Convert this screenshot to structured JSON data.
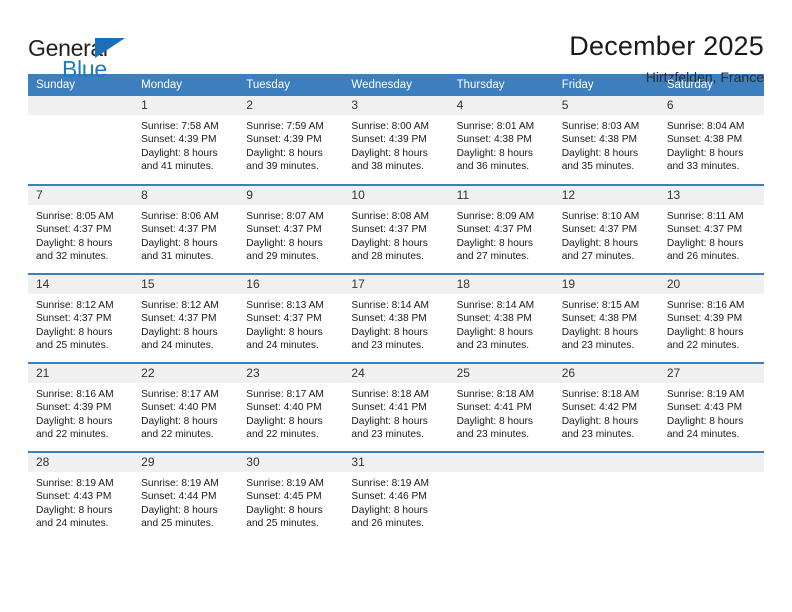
{
  "brand": {
    "name_top": "General",
    "name_bottom": "Blue",
    "triangle_icon": "triangle-icon",
    "color_blue": "#1f7ac4",
    "color_dark": "#231f20"
  },
  "header": {
    "title": "December 2025",
    "subtitle": "Hirtzfelden, France"
  },
  "theme": {
    "header_row_bg": "#3c7ebe",
    "daynum_bg": "#f0f0f0",
    "grid_line": "#3c7ebe"
  },
  "weekdays": [
    "Sunday",
    "Monday",
    "Tuesday",
    "Wednesday",
    "Thursday",
    "Friday",
    "Saturday"
  ],
  "weeks": [
    [
      {
        "day": "",
        "sunrise": "",
        "sunset": "",
        "daylight_line1": "",
        "daylight_line2": ""
      },
      {
        "day": "1",
        "sunrise": "Sunrise: 7:58 AM",
        "sunset": "Sunset: 4:39 PM",
        "daylight_line1": "Daylight: 8 hours",
        "daylight_line2": "and 41 minutes."
      },
      {
        "day": "2",
        "sunrise": "Sunrise: 7:59 AM",
        "sunset": "Sunset: 4:39 PM",
        "daylight_line1": "Daylight: 8 hours",
        "daylight_line2": "and 39 minutes."
      },
      {
        "day": "3",
        "sunrise": "Sunrise: 8:00 AM",
        "sunset": "Sunset: 4:39 PM",
        "daylight_line1": "Daylight: 8 hours",
        "daylight_line2": "and 38 minutes."
      },
      {
        "day": "4",
        "sunrise": "Sunrise: 8:01 AM",
        "sunset": "Sunset: 4:38 PM",
        "daylight_line1": "Daylight: 8 hours",
        "daylight_line2": "and 36 minutes."
      },
      {
        "day": "5",
        "sunrise": "Sunrise: 8:03 AM",
        "sunset": "Sunset: 4:38 PM",
        "daylight_line1": "Daylight: 8 hours",
        "daylight_line2": "and 35 minutes."
      },
      {
        "day": "6",
        "sunrise": "Sunrise: 8:04 AM",
        "sunset": "Sunset: 4:38 PM",
        "daylight_line1": "Daylight: 8 hours",
        "daylight_line2": "and 33 minutes."
      }
    ],
    [
      {
        "day": "7",
        "sunrise": "Sunrise: 8:05 AM",
        "sunset": "Sunset: 4:37 PM",
        "daylight_line1": "Daylight: 8 hours",
        "daylight_line2": "and 32 minutes."
      },
      {
        "day": "8",
        "sunrise": "Sunrise: 8:06 AM",
        "sunset": "Sunset: 4:37 PM",
        "daylight_line1": "Daylight: 8 hours",
        "daylight_line2": "and 31 minutes."
      },
      {
        "day": "9",
        "sunrise": "Sunrise: 8:07 AM",
        "sunset": "Sunset: 4:37 PM",
        "daylight_line1": "Daylight: 8 hours",
        "daylight_line2": "and 29 minutes."
      },
      {
        "day": "10",
        "sunrise": "Sunrise: 8:08 AM",
        "sunset": "Sunset: 4:37 PM",
        "daylight_line1": "Daylight: 8 hours",
        "daylight_line2": "and 28 minutes."
      },
      {
        "day": "11",
        "sunrise": "Sunrise: 8:09 AM",
        "sunset": "Sunset: 4:37 PM",
        "daylight_line1": "Daylight: 8 hours",
        "daylight_line2": "and 27 minutes."
      },
      {
        "day": "12",
        "sunrise": "Sunrise: 8:10 AM",
        "sunset": "Sunset: 4:37 PM",
        "daylight_line1": "Daylight: 8 hours",
        "daylight_line2": "and 27 minutes."
      },
      {
        "day": "13",
        "sunrise": "Sunrise: 8:11 AM",
        "sunset": "Sunset: 4:37 PM",
        "daylight_line1": "Daylight: 8 hours",
        "daylight_line2": "and 26 minutes."
      }
    ],
    [
      {
        "day": "14",
        "sunrise": "Sunrise: 8:12 AM",
        "sunset": "Sunset: 4:37 PM",
        "daylight_line1": "Daylight: 8 hours",
        "daylight_line2": "and 25 minutes."
      },
      {
        "day": "15",
        "sunrise": "Sunrise: 8:12 AM",
        "sunset": "Sunset: 4:37 PM",
        "daylight_line1": "Daylight: 8 hours",
        "daylight_line2": "and 24 minutes."
      },
      {
        "day": "16",
        "sunrise": "Sunrise: 8:13 AM",
        "sunset": "Sunset: 4:37 PM",
        "daylight_line1": "Daylight: 8 hours",
        "daylight_line2": "and 24 minutes."
      },
      {
        "day": "17",
        "sunrise": "Sunrise: 8:14 AM",
        "sunset": "Sunset: 4:38 PM",
        "daylight_line1": "Daylight: 8 hours",
        "daylight_line2": "and 23 minutes."
      },
      {
        "day": "18",
        "sunrise": "Sunrise: 8:14 AM",
        "sunset": "Sunset: 4:38 PM",
        "daylight_line1": "Daylight: 8 hours",
        "daylight_line2": "and 23 minutes."
      },
      {
        "day": "19",
        "sunrise": "Sunrise: 8:15 AM",
        "sunset": "Sunset: 4:38 PM",
        "daylight_line1": "Daylight: 8 hours",
        "daylight_line2": "and 23 minutes."
      },
      {
        "day": "20",
        "sunrise": "Sunrise: 8:16 AM",
        "sunset": "Sunset: 4:39 PM",
        "daylight_line1": "Daylight: 8 hours",
        "daylight_line2": "and 22 minutes."
      }
    ],
    [
      {
        "day": "21",
        "sunrise": "Sunrise: 8:16 AM",
        "sunset": "Sunset: 4:39 PM",
        "daylight_line1": "Daylight: 8 hours",
        "daylight_line2": "and 22 minutes."
      },
      {
        "day": "22",
        "sunrise": "Sunrise: 8:17 AM",
        "sunset": "Sunset: 4:40 PM",
        "daylight_line1": "Daylight: 8 hours",
        "daylight_line2": "and 22 minutes."
      },
      {
        "day": "23",
        "sunrise": "Sunrise: 8:17 AM",
        "sunset": "Sunset: 4:40 PM",
        "daylight_line1": "Daylight: 8 hours",
        "daylight_line2": "and 22 minutes."
      },
      {
        "day": "24",
        "sunrise": "Sunrise: 8:18 AM",
        "sunset": "Sunset: 4:41 PM",
        "daylight_line1": "Daylight: 8 hours",
        "daylight_line2": "and 23 minutes."
      },
      {
        "day": "25",
        "sunrise": "Sunrise: 8:18 AM",
        "sunset": "Sunset: 4:41 PM",
        "daylight_line1": "Daylight: 8 hours",
        "daylight_line2": "and 23 minutes."
      },
      {
        "day": "26",
        "sunrise": "Sunrise: 8:18 AM",
        "sunset": "Sunset: 4:42 PM",
        "daylight_line1": "Daylight: 8 hours",
        "daylight_line2": "and 23 minutes."
      },
      {
        "day": "27",
        "sunrise": "Sunrise: 8:19 AM",
        "sunset": "Sunset: 4:43 PM",
        "daylight_line1": "Daylight: 8 hours",
        "daylight_line2": "and 24 minutes."
      }
    ],
    [
      {
        "day": "28",
        "sunrise": "Sunrise: 8:19 AM",
        "sunset": "Sunset: 4:43 PM",
        "daylight_line1": "Daylight: 8 hours",
        "daylight_line2": "and 24 minutes."
      },
      {
        "day": "29",
        "sunrise": "Sunrise: 8:19 AM",
        "sunset": "Sunset: 4:44 PM",
        "daylight_line1": "Daylight: 8 hours",
        "daylight_line2": "and 25 minutes."
      },
      {
        "day": "30",
        "sunrise": "Sunrise: 8:19 AM",
        "sunset": "Sunset: 4:45 PM",
        "daylight_line1": "Daylight: 8 hours",
        "daylight_line2": "and 25 minutes."
      },
      {
        "day": "31",
        "sunrise": "Sunrise: 8:19 AM",
        "sunset": "Sunset: 4:46 PM",
        "daylight_line1": "Daylight: 8 hours",
        "daylight_line2": "and 26 minutes."
      },
      {
        "day": "",
        "sunrise": "",
        "sunset": "",
        "daylight_line1": "",
        "daylight_line2": ""
      },
      {
        "day": "",
        "sunrise": "",
        "sunset": "",
        "daylight_line1": "",
        "daylight_line2": ""
      },
      {
        "day": "",
        "sunrise": "",
        "sunset": "",
        "daylight_line1": "",
        "daylight_line2": ""
      }
    ]
  ]
}
